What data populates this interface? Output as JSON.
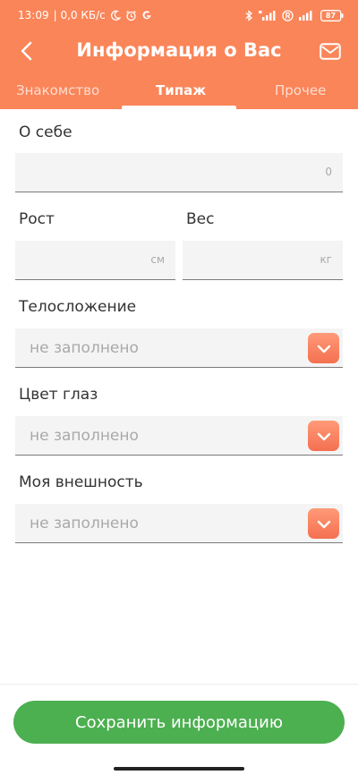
{
  "status_bar": {
    "time": "13:09",
    "network_speed": "| 0,0 КБ/с",
    "battery": "87"
  },
  "header": {
    "title": "Информация о Вас"
  },
  "tabs": [
    {
      "label": "Знакомство",
      "active": false
    },
    {
      "label": "Типаж",
      "active": true
    },
    {
      "label": "Прочее",
      "active": false
    }
  ],
  "form": {
    "about": {
      "label": "О себе",
      "counter": "0"
    },
    "height": {
      "label": "Рост",
      "unit": "см"
    },
    "weight": {
      "label": "Вес",
      "unit": "кг"
    },
    "build": {
      "label": "Телосложение",
      "value": "не заполнено"
    },
    "eye_color": {
      "label": "Цвет глаз",
      "value": "не заполнено"
    },
    "appearance": {
      "label": "Моя внешность",
      "value": "не заполнено"
    }
  },
  "footer": {
    "save_label": "Сохранить информацию"
  },
  "colors": {
    "accent": "#fa8559",
    "save_button": "#4caf50",
    "dropdown_button": "#f47050"
  }
}
